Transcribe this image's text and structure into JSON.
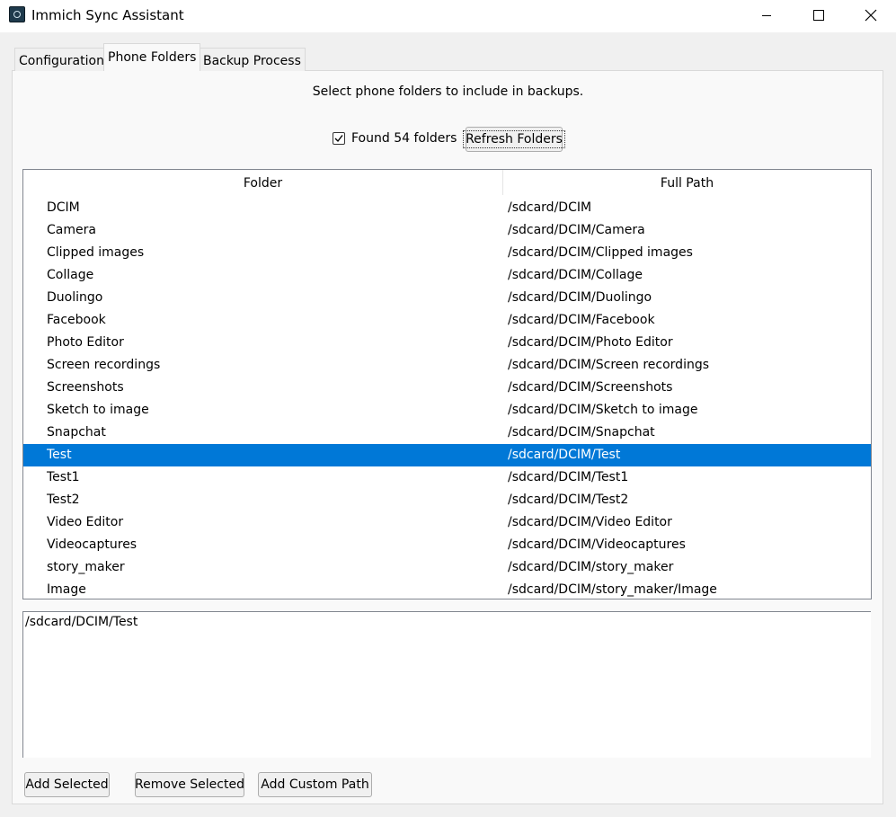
{
  "window": {
    "title": "Immich Sync Assistant",
    "icon": "app-icon"
  },
  "tabs": [
    {
      "label": "Configuration"
    },
    {
      "label": "Phone Folders"
    },
    {
      "label": "Backup Process"
    }
  ],
  "active_tab": "Phone Folders",
  "instruction": "Select phone folders to include in backups.",
  "found": {
    "label": "Found 54 folders",
    "checked": true
  },
  "refresh_label": "Refresh Folders",
  "tree": {
    "columns": [
      "Folder",
      "Full Path"
    ],
    "rows": [
      {
        "folder": "DCIM",
        "path": "/sdcard/DCIM"
      },
      {
        "folder": "Camera",
        "path": "/sdcard/DCIM/Camera"
      },
      {
        "folder": "Clipped images",
        "path": "/sdcard/DCIM/Clipped images"
      },
      {
        "folder": "Collage",
        "path": "/sdcard/DCIM/Collage"
      },
      {
        "folder": "Duolingo",
        "path": "/sdcard/DCIM/Duolingo"
      },
      {
        "folder": "Facebook",
        "path": "/sdcard/DCIM/Facebook"
      },
      {
        "folder": "Photo Editor",
        "path": "/sdcard/DCIM/Photo Editor"
      },
      {
        "folder": "Screen recordings",
        "path": "/sdcard/DCIM/Screen recordings"
      },
      {
        "folder": "Screenshots",
        "path": "/sdcard/DCIM/Screenshots"
      },
      {
        "folder": "Sketch to image",
        "path": "/sdcard/DCIM/Sketch to image"
      },
      {
        "folder": "Snapchat",
        "path": "/sdcard/DCIM/Snapchat"
      },
      {
        "folder": "Test",
        "path": "/sdcard/DCIM/Test"
      },
      {
        "folder": "Test1",
        "path": "/sdcard/DCIM/Test1"
      },
      {
        "folder": "Test2",
        "path": "/sdcard/DCIM/Test2"
      },
      {
        "folder": "Video Editor",
        "path": "/sdcard/DCIM/Video Editor"
      },
      {
        "folder": "Videocaptures",
        "path": "/sdcard/DCIM/Videocaptures"
      },
      {
        "folder": "story_maker",
        "path": "/sdcard/DCIM/story_maker"
      },
      {
        "folder": "Image",
        "path": "/sdcard/DCIM/story_maker/Image"
      }
    ],
    "selected_index": 11,
    "selection_color": "#0078d7"
  },
  "selected_text": "/sdcard/DCIM/Test",
  "buttons": {
    "add_selected": "Add Selected",
    "remove_selected": "Remove Selected",
    "add_custom": "Add Custom Path"
  }
}
